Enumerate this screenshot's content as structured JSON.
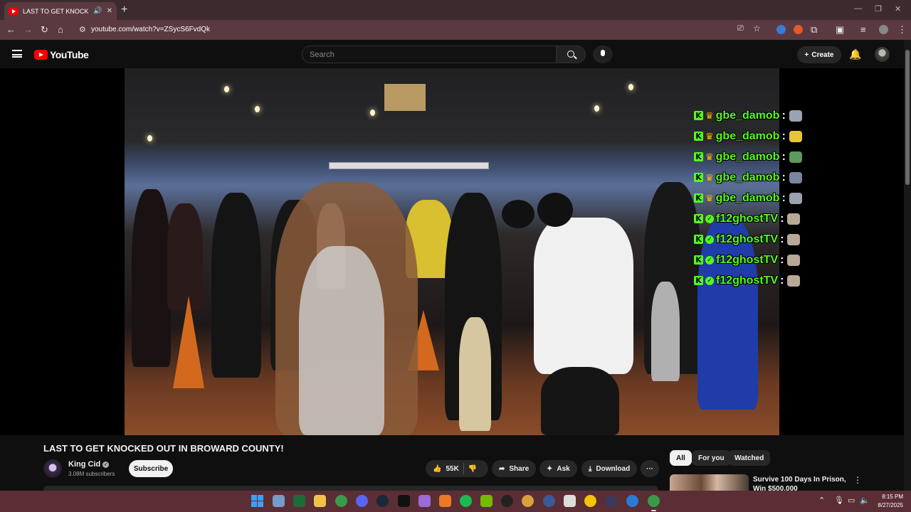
{
  "browser": {
    "tab_title": "LAST TO GET KNOCKED OUT IN BROWARD COUNTY!",
    "url": "youtube.com/watch?v=ZSycS6FvdQk"
  },
  "youtube": {
    "logo_text": "YouTube",
    "search_placeholder": "Search",
    "create_label": "Create"
  },
  "chat": [
    {
      "user": "gbe_damob",
      "badge": "crown",
      "emote_color": "#9aa4b0"
    },
    {
      "user": "gbe_damob",
      "badge": "crown",
      "emote_color": "#e8c63a"
    },
    {
      "user": "gbe_damob",
      "badge": "crown",
      "emote_color": "#5a9a5a"
    },
    {
      "user": "gbe_damob",
      "badge": "crown",
      "emote_color": "#7a86a0"
    },
    {
      "user": "gbe_damob",
      "badge": "crown",
      "emote_color": "#9aa4b0"
    },
    {
      "user": "f12ghostTV",
      "badge": "check",
      "emote_color": "#b8a898"
    },
    {
      "user": "f12ghostTV",
      "badge": "check",
      "emote_color": "#b8a898"
    },
    {
      "user": "f12ghostTV",
      "badge": "check",
      "emote_color": "#b8a898"
    },
    {
      "user": "f12ghostTV",
      "badge": "check",
      "emote_color": "#b8a898"
    }
  ],
  "video": {
    "title": "LAST TO GET KNOCKED OUT IN BROWARD COUNTY!",
    "channel": "King Cid",
    "subscribers": "3.08M subscribers",
    "subscribe_label": "Subscribe",
    "likes": "55K",
    "share_label": "Share",
    "ask_label": "Ask",
    "download_label": "Download"
  },
  "sidebar": {
    "chips": [
      "All",
      "For you",
      "Watched"
    ],
    "recommended_title": "Survive 100 Days In Prison, Win $500,000"
  },
  "taskbar": {
    "time": "8:15 PM",
    "date": "8/27/2025"
  }
}
